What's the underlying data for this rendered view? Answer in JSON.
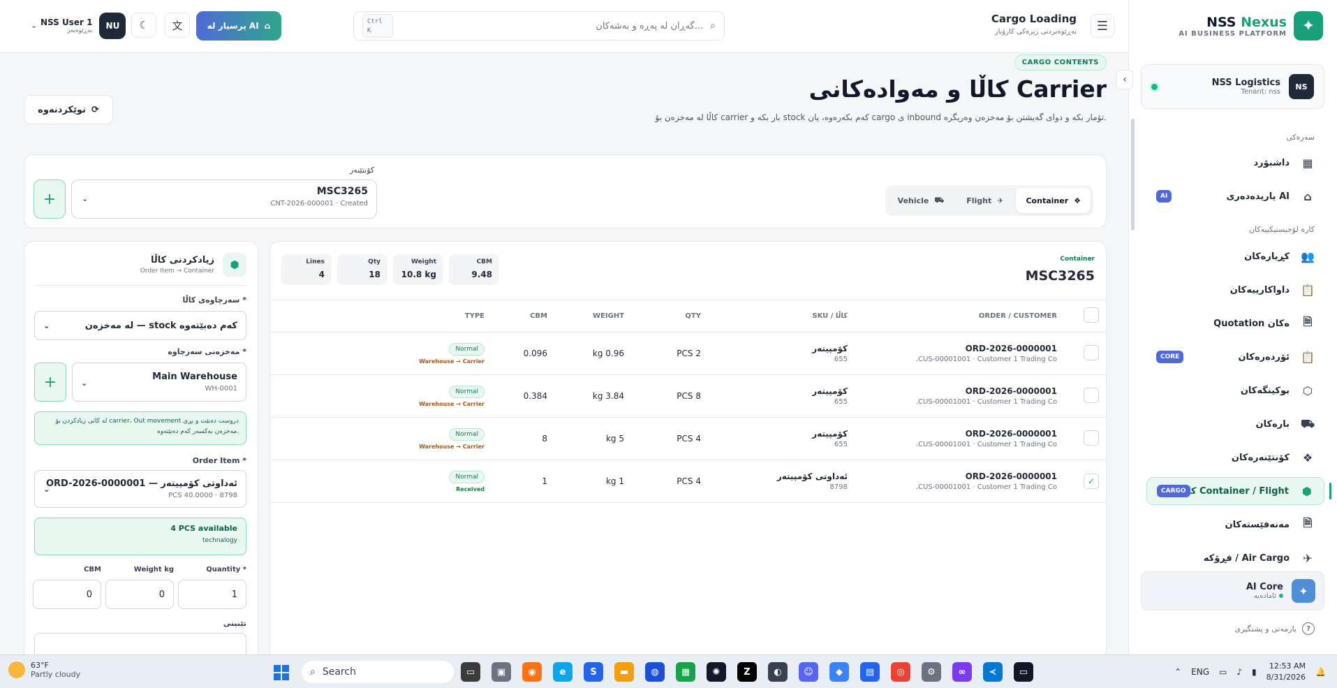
{
  "brand": {
    "name_main": "NSS ",
    "name_accent": "Nexus",
    "subtitle": "AI BUSINESS PLATFORM"
  },
  "tenant": {
    "name": "NSS Logistics",
    "sub": "Tenant: nss",
    "badge": "NS"
  },
  "sidebar": {
    "section_main": "سەرەکی",
    "section_logistics": "کارە لۆجیستیکییەکان",
    "items": [
      {
        "label": "داشبۆرد",
        "icon": "dashboard-icon"
      },
      {
        "label": "یاریدەدەری AI",
        "icon": "robot-icon",
        "tag": "AI"
      },
      {
        "label": "کڕیارەکان",
        "icon": "users-icon"
      },
      {
        "label": "داواکارییەکان",
        "icon": "clipboard-icon"
      },
      {
        "label": "Quotation ەکان",
        "icon": "document-icon"
      },
      {
        "label": "ئۆردەرەکان",
        "icon": "clipboard-check-icon",
        "tag": "CORE"
      },
      {
        "label": "بوکینگەکان",
        "icon": "package-search-icon"
      },
      {
        "label": "بارەکان",
        "icon": "truck-icon"
      },
      {
        "label": "کۆنتێنەرەکان",
        "icon": "containers-icon"
      },
      {
        "label": "کاڵای Container / Flight",
        "icon": "package-plus-icon",
        "tag": "CARGO",
        "active": true
      },
      {
        "label": "مەنەفێستەکان",
        "icon": "file-list-icon"
      },
      {
        "label": "فڕۆکە / Air Cargo",
        "icon": "plane-icon"
      }
    ],
    "core": {
      "name": "AI Core",
      "sub": "ئامادەیە"
    },
    "help": "یارمەتی و پشتگیری"
  },
  "topbar": {
    "title": "Cargo Loading",
    "subtitle": "بەڕێوەبردنی زیرەکی کارۆبار",
    "search_placeholder": "گەڕان لە پەڕە و بەشەکان...",
    "kbd": "Ctrl K",
    "ai_button": "پرسیار لە AI",
    "user_name": "NSS User 1",
    "user_role": "بەڕێوەبەر",
    "user_initials": "NU"
  },
  "page": {
    "pill": "CARGO CONTENTS",
    "title": "کاڵا و مەوادەکانی Carrier",
    "description": "کاڵا لە مەخزەن بۆ carrier بار بکە و stock کەم بکەرەوە، یان cargo ی inbound تۆمار بکە و دوای گەیشتن بۆ مەخزەن وەریگرە.",
    "refresh": "نوێکردنەوە"
  },
  "selector": {
    "tabs": [
      {
        "label": "Container",
        "icon": "container-icon",
        "active": true
      },
      {
        "label": "Flight",
        "icon": "plane-icon",
        "active": false
      },
      {
        "label": "Vehicle",
        "icon": "truck-icon",
        "active": false
      }
    ],
    "label": "کۆنتێنەر",
    "value": "MSC3265",
    "sub": "CNT-2026-000001 · Created"
  },
  "table_card": {
    "kicker": "Container",
    "title": "MSC3265",
    "stats": [
      {
        "k": "Lines",
        "v": "4"
      },
      {
        "k": "Qty",
        "v": "18"
      },
      {
        "k": "Weight",
        "v": "10.8 kg"
      },
      {
        "k": "CBM",
        "v": "9.48"
      }
    ],
    "columns": [
      "ORDER / CUSTOMER",
      "کاڵا / SKU",
      "QTY",
      "WEIGHT",
      "CBM",
      "TYPE"
    ],
    "rows": [
      {
        "order": "ORD-2026-0000001",
        "customer": "CUS-00001001 · Customer 1 Trading Co.",
        "sku": "کۆمپیتەر",
        "sku_code": "655",
        "qty": "2 PCS",
        "weight": "0.96 kg",
        "cbm": "0.096",
        "type": "Normal",
        "flow": "Warehouse → Carrier",
        "flow_kind": "warn",
        "checked": false
      },
      {
        "order": "ORD-2026-0000001",
        "customer": "CUS-00001001 · Customer 1 Trading Co.",
        "sku": "کۆمپیتەر",
        "sku_code": "655",
        "qty": "8 PCS",
        "weight": "3.84 kg",
        "cbm": "0.384",
        "type": "Normal",
        "flow": "Warehouse → Carrier",
        "flow_kind": "warn",
        "checked": false
      },
      {
        "order": "ORD-2026-0000001",
        "customer": "CUS-00001001 · Customer 1 Trading Co.",
        "sku": "کۆمپیتەر",
        "sku_code": "655",
        "qty": "4 PCS",
        "weight": "5 kg",
        "cbm": "8",
        "type": "Normal",
        "flow": "Warehouse → Carrier",
        "flow_kind": "warn",
        "checked": false
      },
      {
        "order": "ORD-2026-0000001",
        "customer": "CUS-00001001 · Customer 1 Trading Co.",
        "sku": "ئەداوتی کۆمپیتەر",
        "sku_code": "8798",
        "qty": "4 PCS",
        "weight": "1 kg",
        "cbm": "1",
        "type": "Normal",
        "flow": "Received",
        "flow_kind": "ok",
        "checked": true
      }
    ]
  },
  "add_panel": {
    "title": "زیادکردنی کاڵا",
    "subtitle": "Order Item → Container",
    "source_label": "سەرچاوەی کاڵا *",
    "source_value": "لە مەخزەن — stock کەم دەبێتەوە",
    "warehouse_label": "مەخزەنی سەرچاوە *",
    "warehouse_value": "Main Warehouse",
    "warehouse_code": "WH-0001",
    "note": "لە کاتی زیادکردن بۆ carrier، Out movement دروست دەبێت و بڕی مەخزەن بەکسەر کەم دەبێتەوە.",
    "order_item_label": "Order Item *",
    "order_item_value": "ORD-2026-0000001 — ئەداوتی کۆمپیتەر",
    "order_item_sub": "PCS 40.0000 · 8798",
    "avail_title": "4 PCS available",
    "avail_sub": "technalogy",
    "qty_label": "Quantity *",
    "qty_value": "1",
    "weight_label": "Weight kg",
    "weight_value": "0",
    "cbm_label": "CBM",
    "cbm_value": "0",
    "notes_label": "تێبینی"
  },
  "taskbar": {
    "temp": "63°F",
    "weather": "Partly cloudy",
    "search": "Search",
    "lang": "ENG",
    "time": "12:53 AM",
    "date": "8/31/2026"
  },
  "colors": {
    "accent": "#17a07a",
    "ai_gradient_start": "#4f6ad8",
    "warn": "#b45309",
    "ok": "#15803d"
  }
}
